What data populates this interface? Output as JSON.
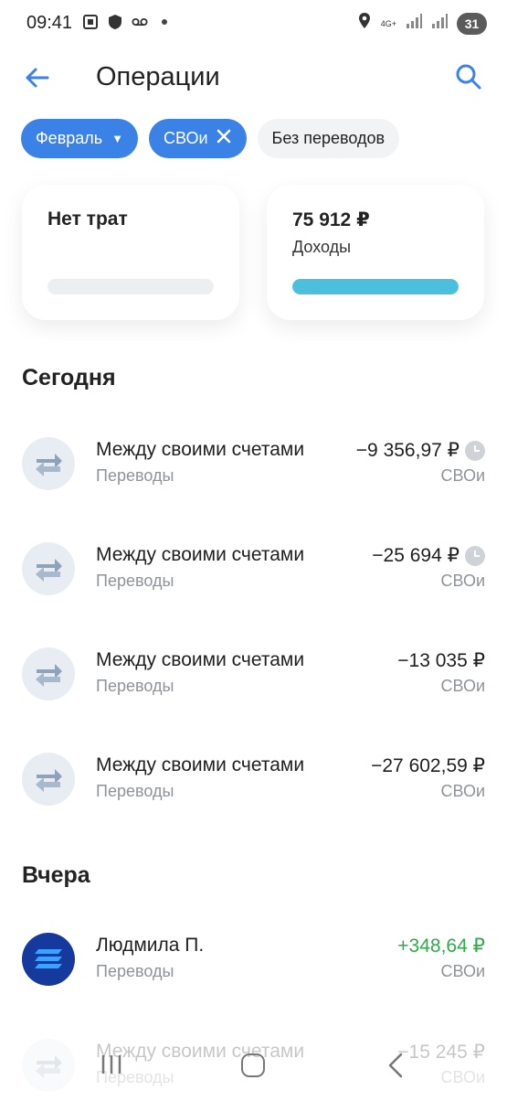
{
  "status_bar": {
    "time": "09:41",
    "network": "4G+",
    "battery": "31"
  },
  "header": {
    "title": "Операции"
  },
  "filters": [
    {
      "label": "Февраль",
      "selected": true,
      "type": "dropdown"
    },
    {
      "label": "СВОи",
      "selected": true,
      "type": "removable"
    },
    {
      "label": "Без переводов",
      "selected": false,
      "type": "toggle"
    }
  ],
  "summary": {
    "spending": {
      "title": "Нет трат",
      "progress": 0
    },
    "income": {
      "amount": "75 912 ₽",
      "label": "Доходы",
      "progress": 1.0,
      "color": "#4bc0dc"
    }
  },
  "sections": [
    {
      "title": "Сегодня",
      "items": [
        {
          "name": "Между своими счетами",
          "category": "Переводы",
          "amount": "−9 356,97 ₽",
          "account": "СВОи",
          "pending": true
        },
        {
          "name": "Между своими счетами",
          "category": "Переводы",
          "amount": "−25 694 ₽",
          "account": "СВОи",
          "pending": true
        },
        {
          "name": "Между своими счетами",
          "category": "Переводы",
          "amount": "−13 035 ₽",
          "account": "СВОи",
          "pending": false
        },
        {
          "name": "Между своими счетами",
          "category": "Переводы",
          "amount": "−27 602,59 ₽",
          "account": "СВОи",
          "pending": false
        }
      ]
    },
    {
      "title": "Вчера",
      "items": [
        {
          "name": "Людмила П.",
          "category": "Переводы",
          "amount": "+348,64 ₽",
          "account": "СВОи",
          "pending": false
        },
        {
          "name": "Между своими счетами",
          "category": "Переводы",
          "amount": "−15 245 ₽",
          "account": "СВОи",
          "pending": false
        }
      ]
    }
  ],
  "colors": {
    "accent": "#3b82e6",
    "income_green": "#2eaa4a",
    "dark_avatar": "#16399e"
  },
  "icons": [
    "back-arrow-icon",
    "search-icon",
    "transfer-icon",
    "clock-icon",
    "bank-logo-icon"
  ]
}
